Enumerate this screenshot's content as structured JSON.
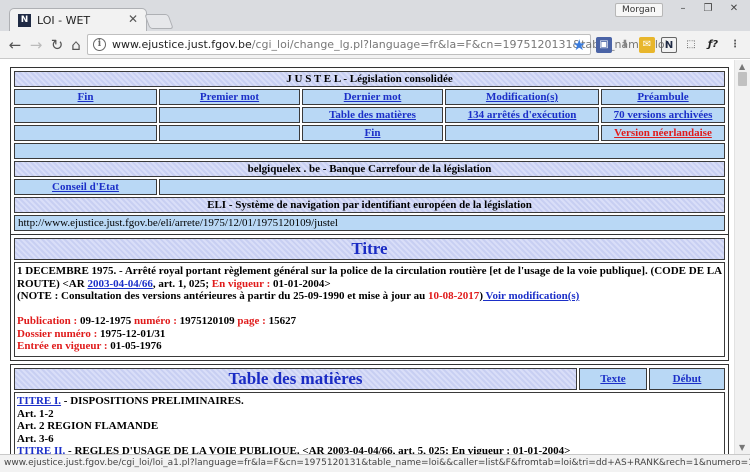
{
  "browser": {
    "tab_title": "LOI - WET",
    "favicon": "N",
    "profile": "Morgan",
    "url_host": "www.ejustice.just.fgov.be",
    "url_path": "/cgi_loi/change_lg.pl?language=fr&la=F&cn=1975120131&table_name=loi",
    "status_url": "www.ejustice.just.fgov.be/cgi_loi/loi_a1.pl?language=fr&la=F&cn=1975120131&table_name=loi&&caller=list&F&fromtab=loi&tri=dd+AS+RANK&rech=1&numero=1&sql=(text+contains+(%27%27))"
  },
  "header": {
    "title": "J U S T E L     -     Législation consolidée",
    "links_row1": [
      "Fin",
      "Premier mot",
      "Dernier mot",
      "Modification(s)",
      "Préambule"
    ],
    "links_row2": [
      "Table des matières",
      "134 arrêtés d'exécution",
      "70 versions archivées"
    ],
    "link_row3_fin": "Fin",
    "link_row3_version": "Version néerlandaise",
    "banner": "belgiquelex . be     -     Banque Carrefour de la législation",
    "conseil": "Conseil d'Etat",
    "eli": "ELI - Système de navigation par identifiant européen de la législation",
    "eli_url": "http://www.ejustice.just.fgov.be/eli/arrete/1975/12/01/1975120109/justel"
  },
  "titre": {
    "heading": "Titre",
    "text1": "1 DECEMBRE 1975. - Arrêté royal portant règlement général sur la police de la circulation routière [et de l'usage de la voie publique]. (CODE DE LA ROUTE) <AR ",
    "ar_link": "2003-04-04/66",
    "text2": ", art. 1, 025; ",
    "en_vigueur_label": "En vigueur :",
    "en_vigueur_date": " 01-01-2004>",
    "note1": "(NOTE : Consultation des versions antérieures à partir du 25-09-1990 et mise à jour au ",
    "note_date": "10-08-2017",
    "note_close": ")",
    "voir_link": " Voir modification(s) ",
    "publication_label": "Publication :",
    "publication_value": " 09-12-1975 ",
    "numero_label": "numéro :",
    "numero_value": "   1975120109 ",
    "page_label": "page :",
    "page_value": " 15627",
    "dossier_label": "Dossier numéro :",
    "dossier_value": " 1975-12-01/31",
    "entree_label": "Entrée en vigueur :",
    "entree_value": " 01-05-1976"
  },
  "toc": {
    "heading": "Table des matières",
    "texte": "Texte",
    "debut": "Début",
    "items": [
      {
        "link": "TITRE I.",
        "text": " - DISPOSITIONS PRELIMINAIRES."
      },
      {
        "link": "",
        "text": "Art. 1-2"
      },
      {
        "link": "",
        "text": "Art. 2 REGION FLAMANDE"
      },
      {
        "link": "",
        "text": "Art. 3-6"
      },
      {
        "link": "TITRE II.",
        "text": " - REGLES D'USAGE DE LA VOIE PUBLIQUE. <AR 2003-04-04/66, art. 5, 025; En vigueur : 01-01-2004>"
      }
    ]
  }
}
